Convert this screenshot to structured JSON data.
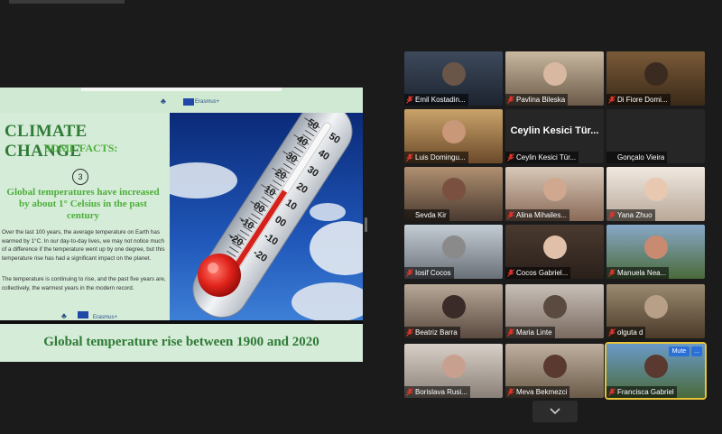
{
  "shared_screen": {
    "page1": {
      "erasmus_label": "Erasmus+",
      "title": "CLIMATE CHANGE",
      "subtitle": "SOME FACTS:",
      "fact_number": "3",
      "fact_heading": "Global temperatures have increased by about 1° Celsius in the past century",
      "body_paragraph_1": "Over the last 100 years, the average temperature on Earth has warmed by 1°C. In our day-to-day lives, we may not notice much of a difference if the temperature went up by one degree, but this temperature rise has had a significant impact on the planet.",
      "body_paragraph_2": "The temperature is continuing to rise, and the past five years are, collectively, the warmest years in the modern record.",
      "footer_erasmus_label": "Erasmus+"
    },
    "thermometer": {
      "left_scale": [
        "50",
        "40",
        "30",
        "20",
        "10",
        "00",
        "-10",
        "-20"
      ],
      "right_scale": [
        "50",
        "40",
        "30",
        "20",
        "10",
        "00",
        "-10",
        "-20"
      ]
    },
    "page2": {
      "title": "Global temperature rise between 1900 and 2020"
    }
  },
  "participants": [
    {
      "name": "Emil Kostadin...",
      "muted": true
    },
    {
      "name": "Pavlina Bileska",
      "muted": true
    },
    {
      "name": "Di Fiore Domi...",
      "muted": true
    },
    {
      "name": "Luis Domingu...",
      "muted": true
    },
    {
      "name": "Ceylin Kesici Tür...",
      "muted": true,
      "no_video": true
    },
    {
      "name": "Gonçalo Vieira",
      "muted": false
    },
    {
      "name": "Sevda Kir",
      "muted": false
    },
    {
      "name": "Alina Mihailes...",
      "muted": true
    },
    {
      "name": "Yana Zhuo",
      "muted": true
    },
    {
      "name": "Iosif Cocos",
      "muted": true
    },
    {
      "name": "Cocos Gabriel...",
      "muted": true
    },
    {
      "name": "Manuela Nea...",
      "muted": true
    },
    {
      "name": "Beatriz Barra",
      "muted": true
    },
    {
      "name": "Maria Linte",
      "muted": true
    },
    {
      "name": "olguta d",
      "muted": true
    },
    {
      "name": "Borislava Rusi...",
      "muted": true
    },
    {
      "name": "Meva Bekmezci",
      "muted": true
    },
    {
      "name": "Francisca Gabriel",
      "muted": true,
      "active_speaker": true
    }
  ],
  "tile_controls": {
    "mute_label": "Mute",
    "more_label": "..."
  },
  "colors": {
    "slide_green": "#d4ecd8",
    "title_green": "#2f7a35",
    "accent_green": "#4fae3c",
    "mic_muted_red": "#e0352b",
    "active_outline": "#e8c33a",
    "button_blue": "#2a70d8"
  }
}
